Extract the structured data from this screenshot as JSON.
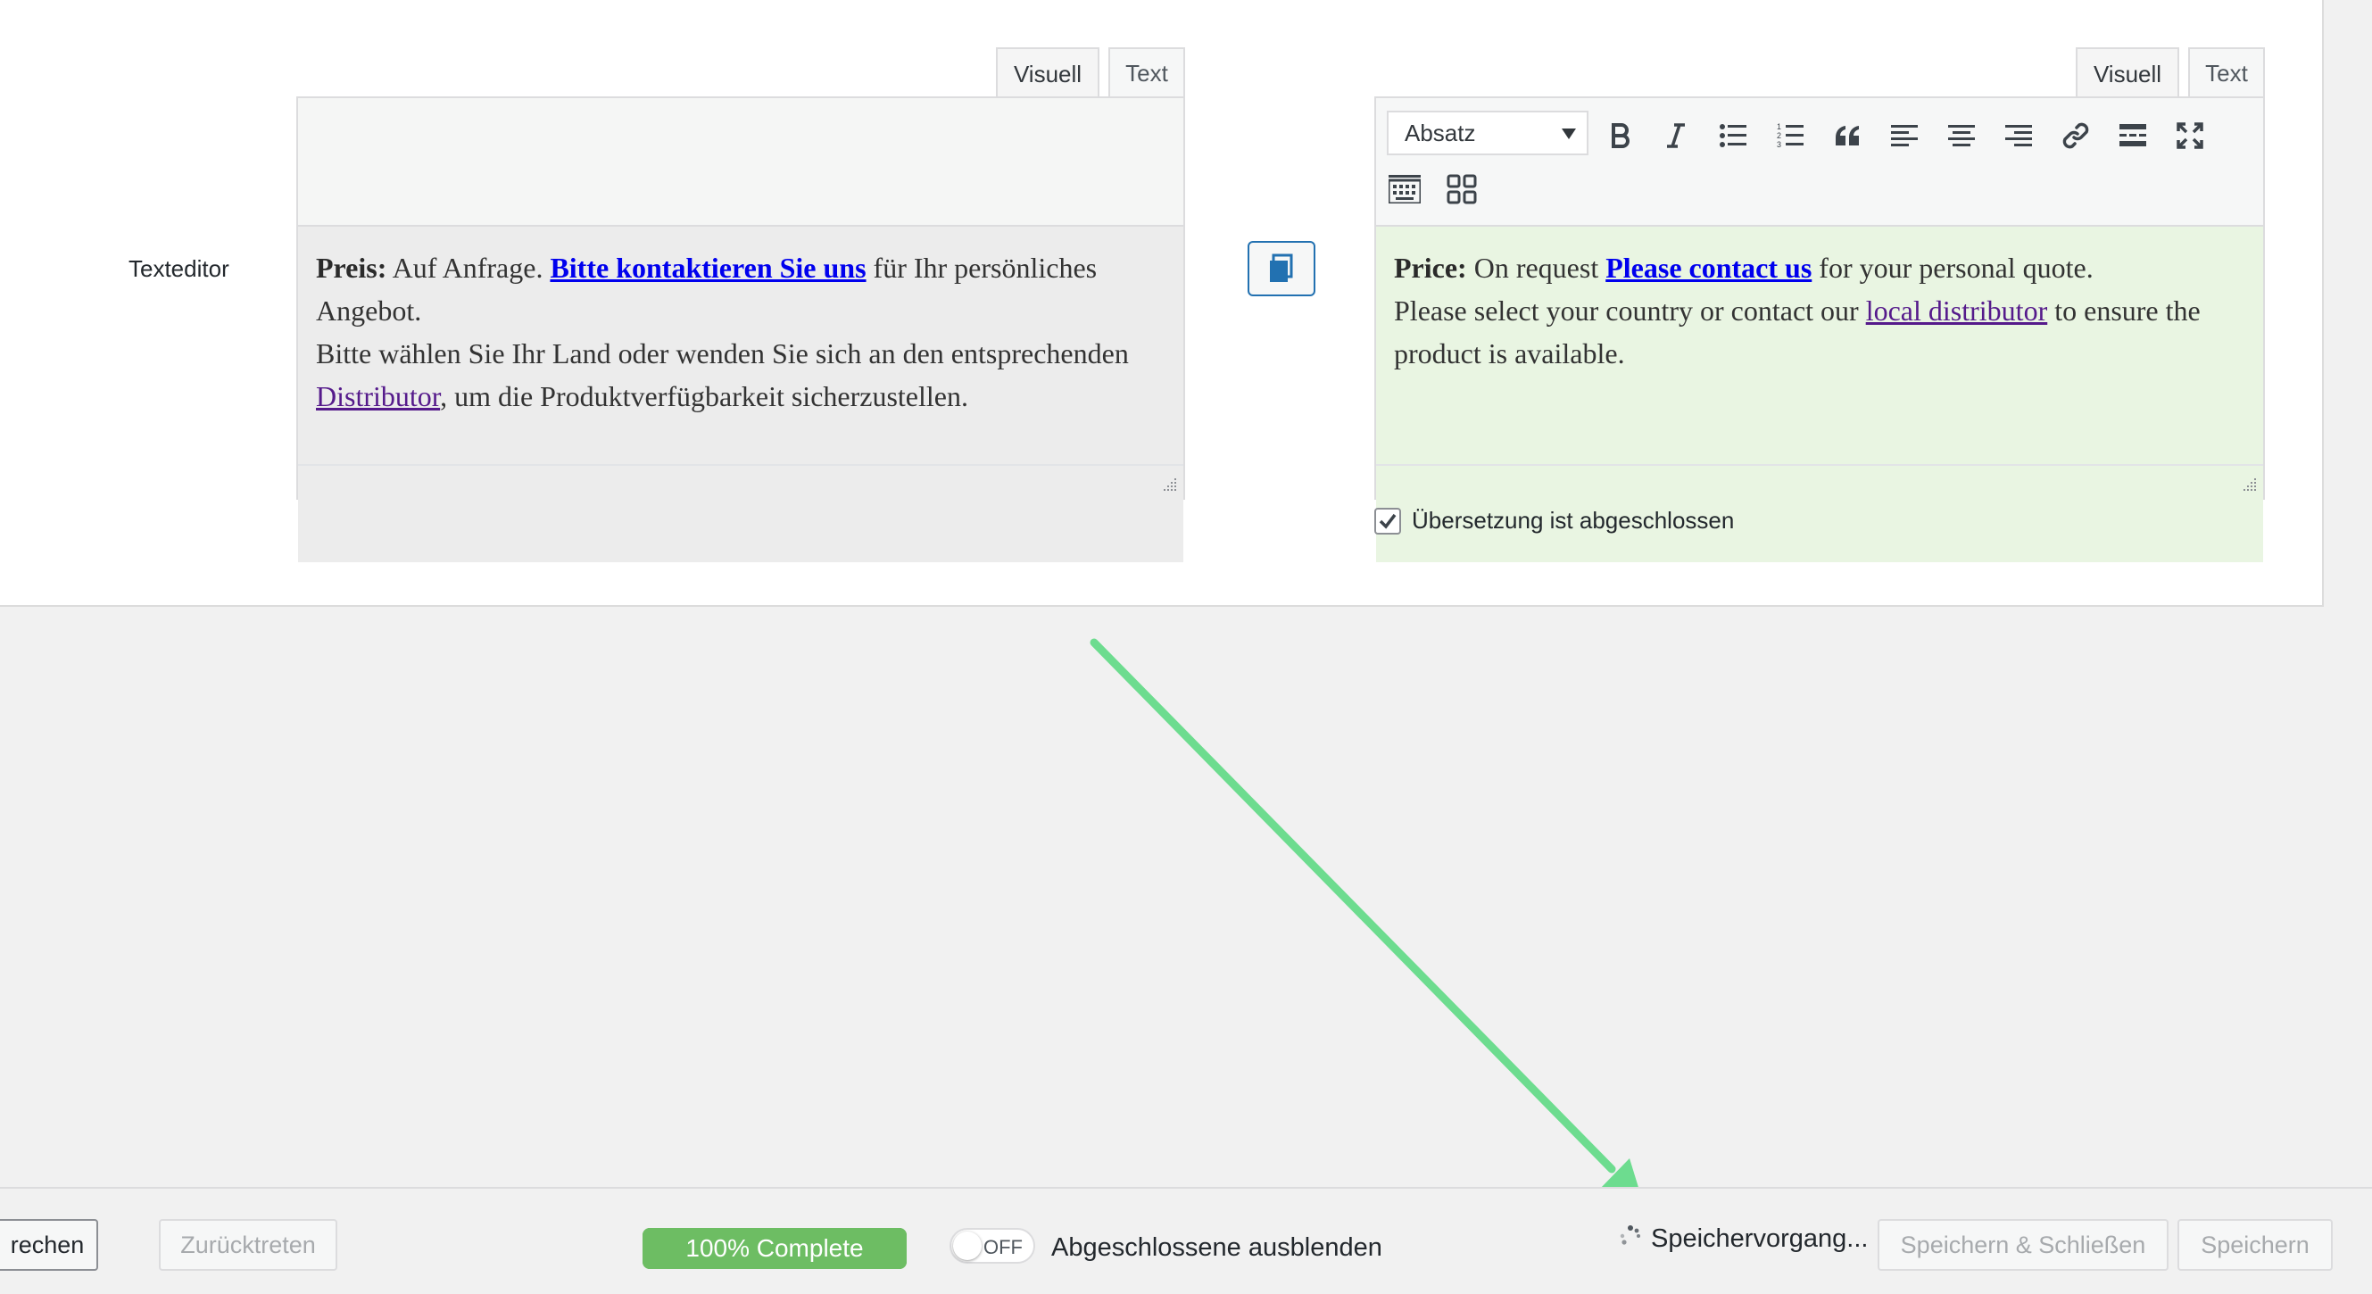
{
  "field": {
    "label": "Texteditor"
  },
  "left_editor": {
    "tabs": [
      "Visuell",
      "Text"
    ],
    "active_tab": "Visuell",
    "content": {
      "p1_bold": "Preis:",
      "p1_text": " Auf Anfrage. ",
      "p1_link": "Bitte kontaktieren Sie uns",
      "p1_after": " für Ihr persönliches Angebot.",
      "p2_text": "Bitte wählen Sie Ihr Land oder wenden Sie sich an den entsprechenden ",
      "p2_link": "Distributor",
      "p2_after": ", um die Produktverfügbarkeit sicherzustellen."
    }
  },
  "right_editor": {
    "tabs": [
      "Visuell",
      "Text"
    ],
    "active_tab": "Visuell",
    "format_select": "Absatz",
    "toolbar_icons": [
      "bold-icon",
      "italic-icon",
      "bullet-list-icon",
      "numbered-list-icon",
      "blockquote-icon",
      "align-left-icon",
      "align-center-icon",
      "align-right-icon",
      "link-icon",
      "read-more-icon",
      "fullscreen-icon",
      "keyboard-icon",
      "grid-icon"
    ],
    "content": {
      "p1_bold": "Price:",
      "p1_text": " On request ",
      "p1_link": "Please contact us",
      "p1_after": " for your personal quote.",
      "p2_text": "Please select your country or contact our ",
      "p2_link": "local distributor",
      "p2_after": " to ensure the product is available."
    },
    "translation_complete_label": "Übersetzung ist abgeschlossen",
    "translation_complete_checked": true
  },
  "footer": {
    "left_button_partial": "rechen",
    "back_button": "Zurücktreten",
    "progress_label": "100% Complete",
    "progress_value": 1.0,
    "toggle_label": "OFF",
    "hide_completed_label": "Abgeschlossene ausblenden",
    "saving_status": "Speichervorgang...",
    "save_close_button": "Speichern & Schließen",
    "save_button": "Speichern"
  },
  "colors": {
    "annotation_arrow": "#6ddc8f",
    "progress_green": "#6dbd63",
    "translation_bg": "#e9f5e2",
    "link_blue": "#0000ee",
    "link_visited": "#551a8b"
  }
}
